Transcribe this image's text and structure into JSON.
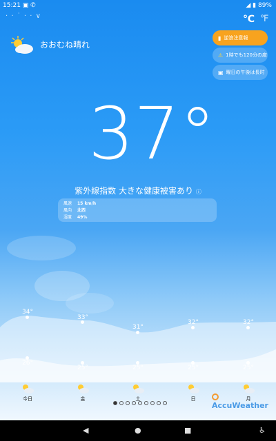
{
  "status": {
    "time": "15:21",
    "icons_left": "▣ ✆",
    "battery": "89%"
  },
  "location": {
    "name": "· · ˙ · ·  ∨"
  },
  "units": {
    "celsius": "℃",
    "fahrenheit": "℉"
  },
  "current": {
    "condition": "おおむね晴れ",
    "temperature": "37°",
    "uv": "紫外線指数 大きな健康被害あり",
    "uv_info": "ⓘ"
  },
  "alerts": [
    {
      "icon": "▮",
      "text": "逆浪注意報"
    },
    {
      "icon": "⚠",
      "text": "1時でも120分の度"
    },
    {
      "icon": "▣",
      "text": "曜日の午後は長时"
    }
  ],
  "details": [
    {
      "label": "風速",
      "value": "15 km/h"
    },
    {
      "label": "風向",
      "value": "北西"
    },
    {
      "label": "湿度",
      "value": "49%"
    }
  ],
  "forecast": {
    "highs": [
      "34°",
      "33°",
      "31°",
      "32°",
      "32°"
    ],
    "lows": [
      "26°",
      "25°",
      "25°",
      "25°",
      "25°"
    ],
    "days": [
      "今日",
      "金",
      "土",
      "日",
      "月"
    ]
  },
  "brand": {
    "name": "AccuWeather"
  },
  "colors": {
    "accent_orange": "#f8a31e",
    "brand_blue": "#4a9be6"
  }
}
